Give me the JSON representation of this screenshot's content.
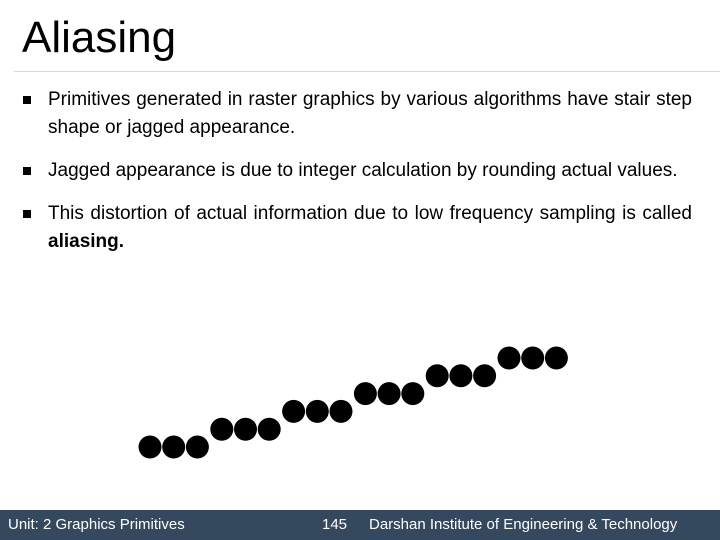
{
  "slide": {
    "title": "Aliasing",
    "bullets": [
      {
        "text": "Primitives generated in raster graphics by various algorithms have stair step shape or jagged appearance.",
        "bold": ""
      },
      {
        "text": "Jagged appearance is due to integer calculation by rounding actual values.",
        "bold": ""
      },
      {
        "text": "This distortion of actual information due to low frequency sampling is called ",
        "bold": "aliasing."
      }
    ],
    "illustration": {
      "description": "staircase of pixel dots",
      "groups": 6,
      "dots_per_group": 3,
      "dot_color": "#000000"
    }
  },
  "footer": {
    "unit": "Unit: 2 Graphics Primitives",
    "page_number": "145",
    "institute": "Darshan Institute of Engineering & Technology",
    "background_color": "#34495e"
  }
}
